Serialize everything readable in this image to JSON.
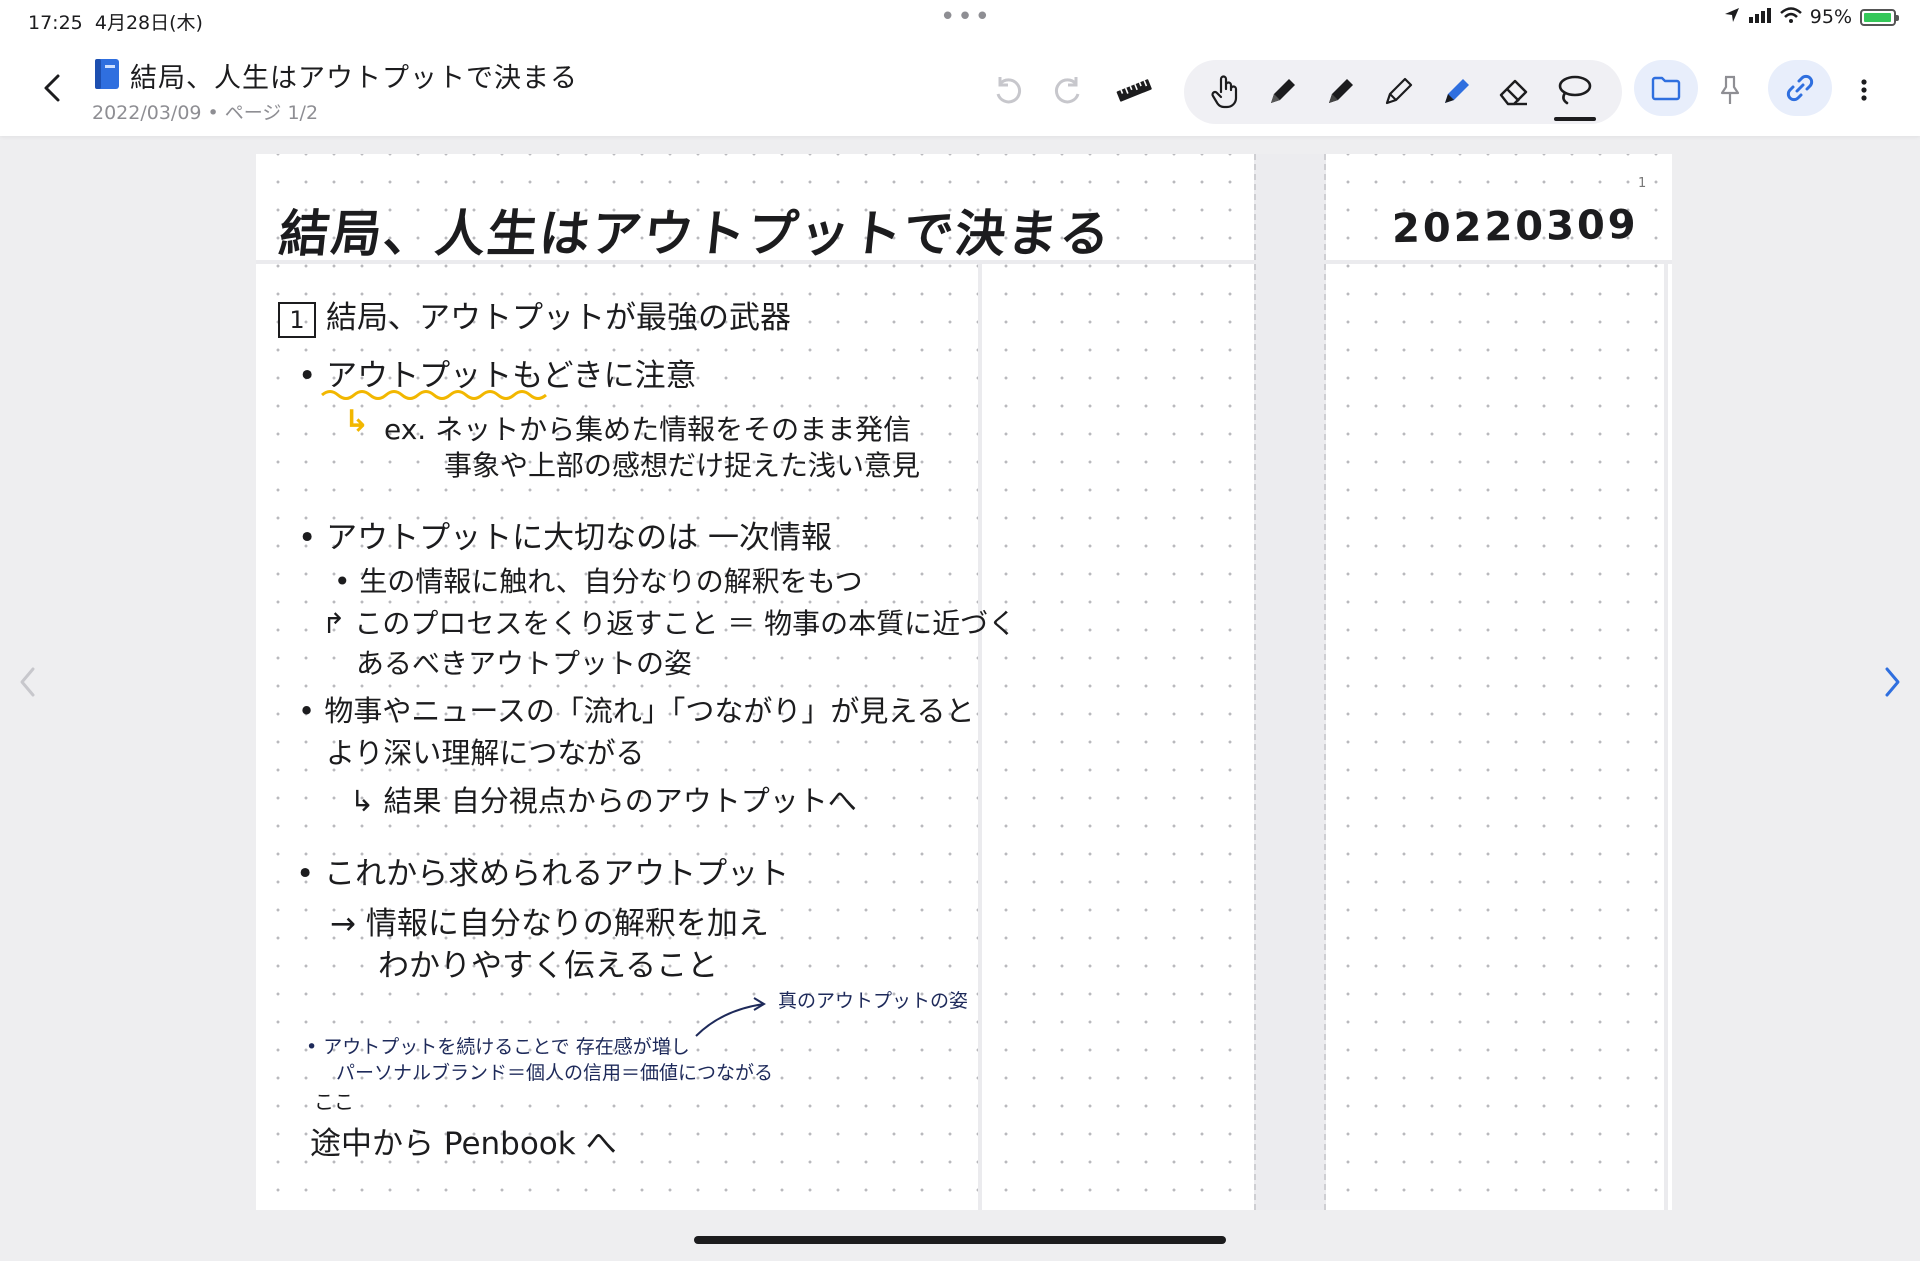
{
  "status": {
    "time": "17:25",
    "date": "4月28日(木)",
    "battery": "95%"
  },
  "header": {
    "title_icon": "blue-notebook-icon",
    "title": "結局、人生はアウトプットで決まる",
    "subtitle": "2022/03/09 • ページ 1/2",
    "icons": [
      "back-chevron-icon",
      "undo-icon",
      "redo-icon",
      "ruler-icon",
      "hand-icon",
      "pen-icon",
      "pen-icon",
      "pencil-icon",
      "highlighter-icon",
      "eraser-icon",
      "lasso-icon",
      "folder-icon",
      "pin-icon",
      "link-icon",
      "more-vertical-icon"
    ],
    "colors": {
      "accent": "#2f6fdf",
      "highlighter": "#2f6fdf",
      "pill": "#e8eefb"
    }
  },
  "note": {
    "page_number": "1",
    "title": "結局、人生はアウトプットで決まる",
    "date": "20220309",
    "section": {
      "number": "1",
      "title": "結局、アウトプットが最強の武器"
    },
    "lines": {
      "b1": "• アウトプットもどきに注意",
      "b1_arrow": "↳",
      "b1_ex": "ex. ネットから集めた情報をそのまま発信",
      "b1_ex2": "事象や上部の感想だけ捉えた浅い意見",
      "b2": "• アウトプットに大切なのは 一次情報",
      "b2_a": "• 生の情報に触れ、自分なりの解釈をもつ",
      "b2_b": "↱ このプロセスをくり返すこと ＝ 物事の本質に近づく",
      "b2_c": "あるべきアウトプットの姿",
      "b3": "• 物事やニュースの「流れ」「つながり」が見えると",
      "b3_a": "より深い理解につながる",
      "b3_b": "↳ 結果  自分視点からのアウトプットへ",
      "b4": "• これから求められるアウトプット",
      "b4_a": "→ 情報に自分なりの解釈を加え",
      "b4_b": "わかりやすく伝えること",
      "annot": "真のアウトプットの姿",
      "s1": "• アウトプットを続けることで 存在感が増し",
      "s2": "パーソナルブランド＝個人の信用＝価値につながる",
      "mark": "ここ",
      "last": "途中から Penbook へ"
    },
    "colors": {
      "ink": "#1c1c1e",
      "yellow": "#f2b700",
      "navy": "#1e2a5a",
      "accent_arrow": "#2f6fdf"
    }
  }
}
